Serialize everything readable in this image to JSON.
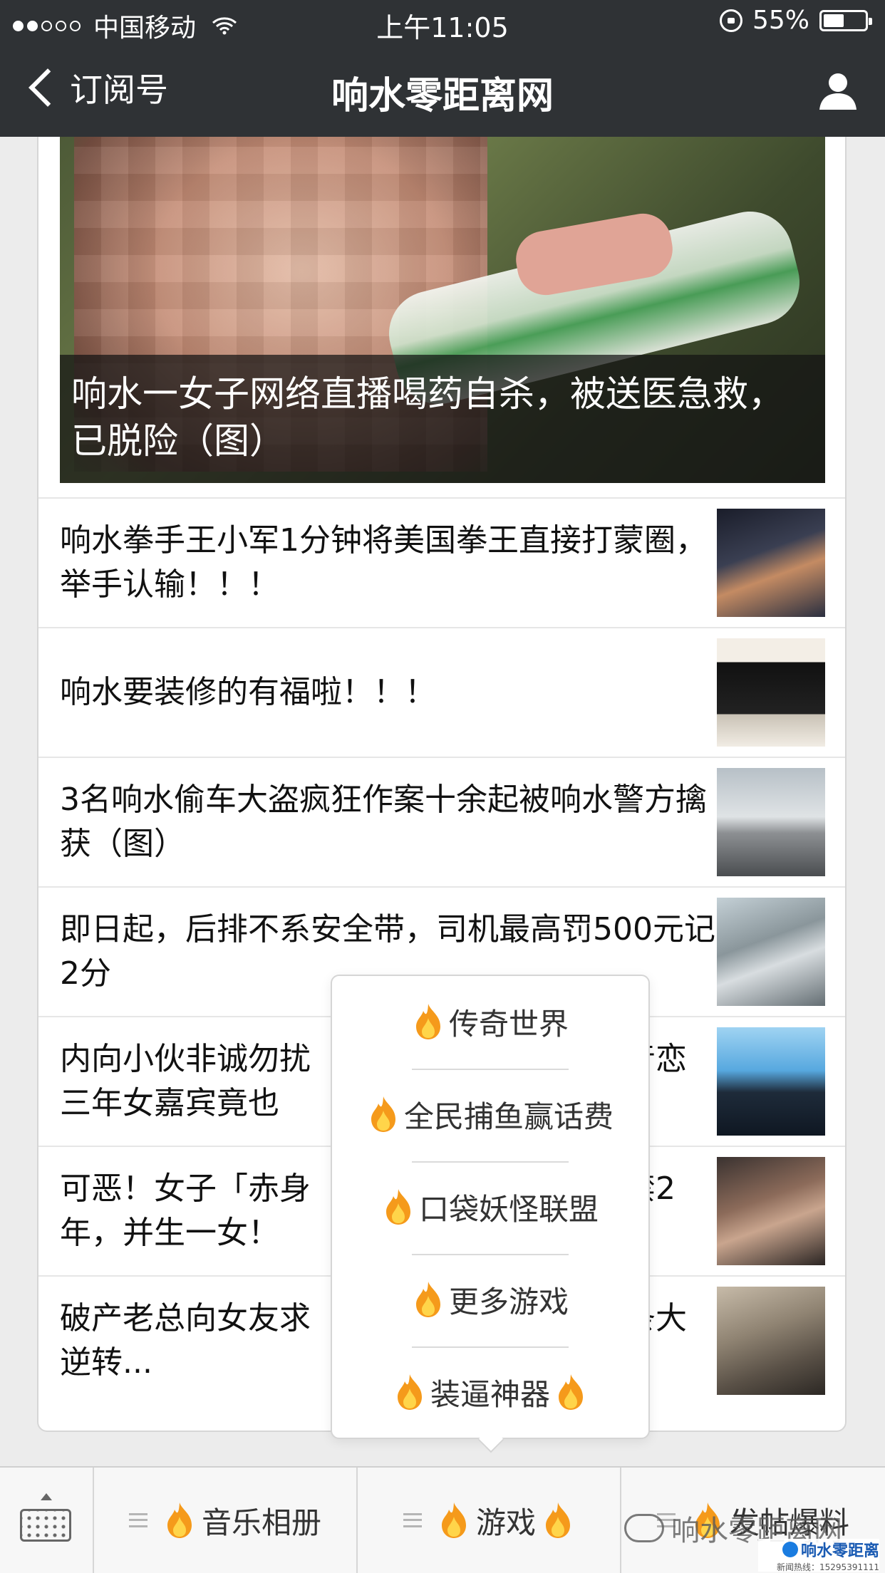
{
  "status_bar": {
    "carrier": "中国移动",
    "time": "上午11:05",
    "battery": "55%",
    "battery_level": 0.55
  },
  "nav": {
    "back_label": "订阅号",
    "title": "响水零距离网"
  },
  "hero": {
    "caption": "响水一女子网络直播喝药自杀，被送医急救，已脱险（图）"
  },
  "articles": [
    {
      "title": "响水拳手王小军1分钟将美国拳王直接打蒙圈，举手认输！！！"
    },
    {
      "title": "响水要装修的有福啦！！！"
    },
    {
      "title": "3名响水偷车大盗疯狂作案十余起被响水警方擒获（图）"
    },
    {
      "title": "即日起，后排不系安全带，司机最高罚500元记2分"
    },
    {
      "title": "内向小伙非诚勿扰　　　　　　　　　　音恋三年女嘉宾竟也"
    },
    {
      "title": "可恶！女子「赤身　　　　　　　　　　禁2年，并生一女！"
    },
    {
      "title": "破产老总向女友求　　　　　　　　　　条大逆转..."
    }
  ],
  "popup_menu": {
    "items": [
      {
        "label": "传奇世界"
      },
      {
        "label": "全民捕鱼赢话费"
      },
      {
        "label": "口袋妖怪联盟"
      },
      {
        "label": "更多游戏"
      },
      {
        "label": "装逼神器"
      }
    ]
  },
  "bottom_menu": {
    "tabs": [
      {
        "label": "音乐相册"
      },
      {
        "label": "游戏"
      },
      {
        "label": "发帖爆料"
      }
    ]
  },
  "watermark": {
    "text": "响水零距离网",
    "site_logo": "响水零距离",
    "hotline": "新闻热线：15295391111"
  },
  "icons": {
    "back": "chevron-left-icon",
    "user": "user-icon",
    "fire": "fire-icon",
    "keyboard": "keyboard-icon",
    "menu": "menu-lines-icon"
  },
  "colors": {
    "nav_bg": "#2f3235",
    "page_bg": "#ececec",
    "fire_outer": "#f59a1b",
    "fire_inner": "#ffd54a"
  }
}
